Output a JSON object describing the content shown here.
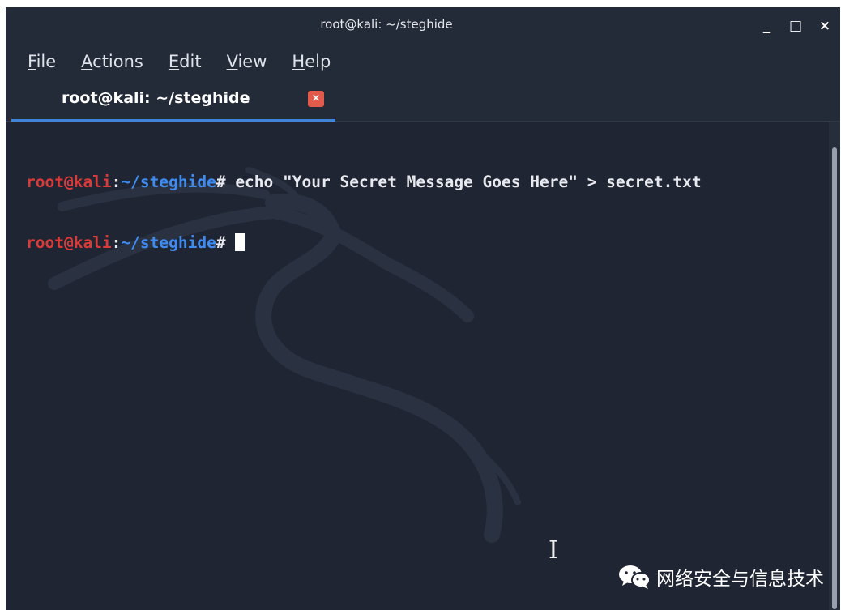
{
  "window": {
    "title": "root@kali: ~/steghide",
    "controls": {
      "minimize": "_",
      "maximize": "□",
      "close": "×"
    }
  },
  "menu": [
    {
      "mnemonic": "F",
      "rest": "ile"
    },
    {
      "mnemonic": "A",
      "rest": "ctions"
    },
    {
      "mnemonic": "E",
      "rest": "dit"
    },
    {
      "mnemonic": "V",
      "rest": "iew"
    },
    {
      "mnemonic": "H",
      "rest": "elp"
    }
  ],
  "tab": {
    "label": "root@kali: ~/steghide",
    "close_glyph": "×"
  },
  "terminal": {
    "prompt_user": "root@kali",
    "prompt_colon": ":",
    "prompt_path": "~/steghide",
    "prompt_hash": "#",
    "lines": [
      {
        "command": " echo \"Your Secret Message Goes Here\" > secret.txt"
      },
      {
        "command": " "
      }
    ]
  },
  "mouse_cursor_glyph": "I",
  "watermark": {
    "icon": "wechat-icon",
    "text": "网络安全与信息技术"
  },
  "colors": {
    "background": "#1f2532",
    "prompt_user": "#d93a3a",
    "prompt_path": "#3f8bf0",
    "tab_accent": "#3f85d9",
    "tab_close": "#e25a4a"
  }
}
